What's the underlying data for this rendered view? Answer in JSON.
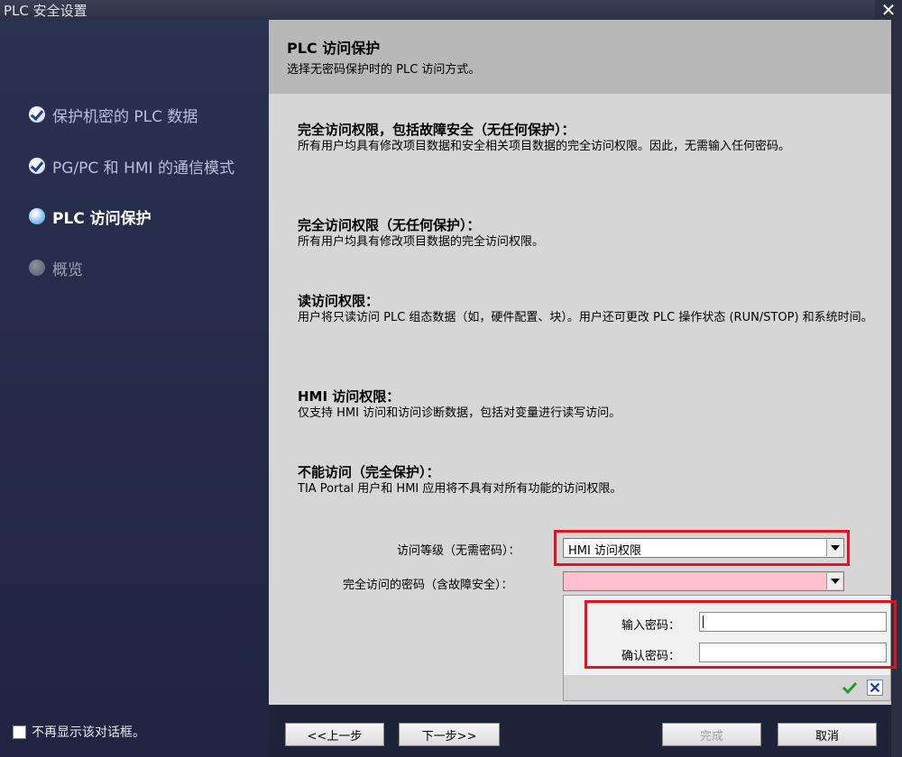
{
  "window": {
    "title": "PLC 安全设置"
  },
  "steps": [
    {
      "label": "保护机密的 PLC 数据",
      "state": "done"
    },
    {
      "label": "PG/PC 和 HMI 的通信模式",
      "state": "done"
    },
    {
      "label": "PLC 访问保护",
      "state": "current"
    },
    {
      "label": "概览",
      "state": "pending"
    }
  ],
  "dont_show_label": "不再显示该对话框。",
  "header": {
    "title": "PLC 访问保护",
    "subtitle": "选择无密码保护时的 PLC 访问方式。"
  },
  "levels": [
    {
      "title": "完全访问权限，包括故障安全（无任何保护）：",
      "text": "所有用户均具有修改项目数据和安全相关项目数据的完全访问权限。因此，无需输入任何密码。"
    },
    {
      "title": "完全访问权限（无任何保护）：",
      "text": "所有用户均具有修改项目数据的完全访问权限。"
    },
    {
      "title": "读访问权限：",
      "text": "用户将只读访问 PLC 组态数据（如，硬件配置、块）。用户还可更改 PLC 操作状态 (RUN/STOP) 和系统时间。"
    },
    {
      "title": "HMI 访问权限：",
      "text": "仅支持 HMI 访问和访问诊断数据，包括对变量进行读写访问。"
    },
    {
      "title": "不能访问（完全保护）：",
      "text": "TIA Portal 用户和 HMI 应用将不具有对所有功能的访问权限。"
    }
  ],
  "form": {
    "access_level_label": "访问等级（无需密码）：",
    "access_level_value": "HMI 访问权限",
    "full_access_pw_label": "完全访问的密码（含故障安全）：",
    "full_access_pw_value": "",
    "enter_pw_label": "输入密码：",
    "confirm_pw_label": "确认密码：",
    "enter_pw_value": "",
    "confirm_pw_value": ""
  },
  "buttons": {
    "back": "<<上一步",
    "next": "下一步>>",
    "finish": "完成",
    "cancel": "取消"
  },
  "colors": {
    "highlight_red": "#e0141e",
    "pw_field_pink": "#ffc0cb"
  }
}
